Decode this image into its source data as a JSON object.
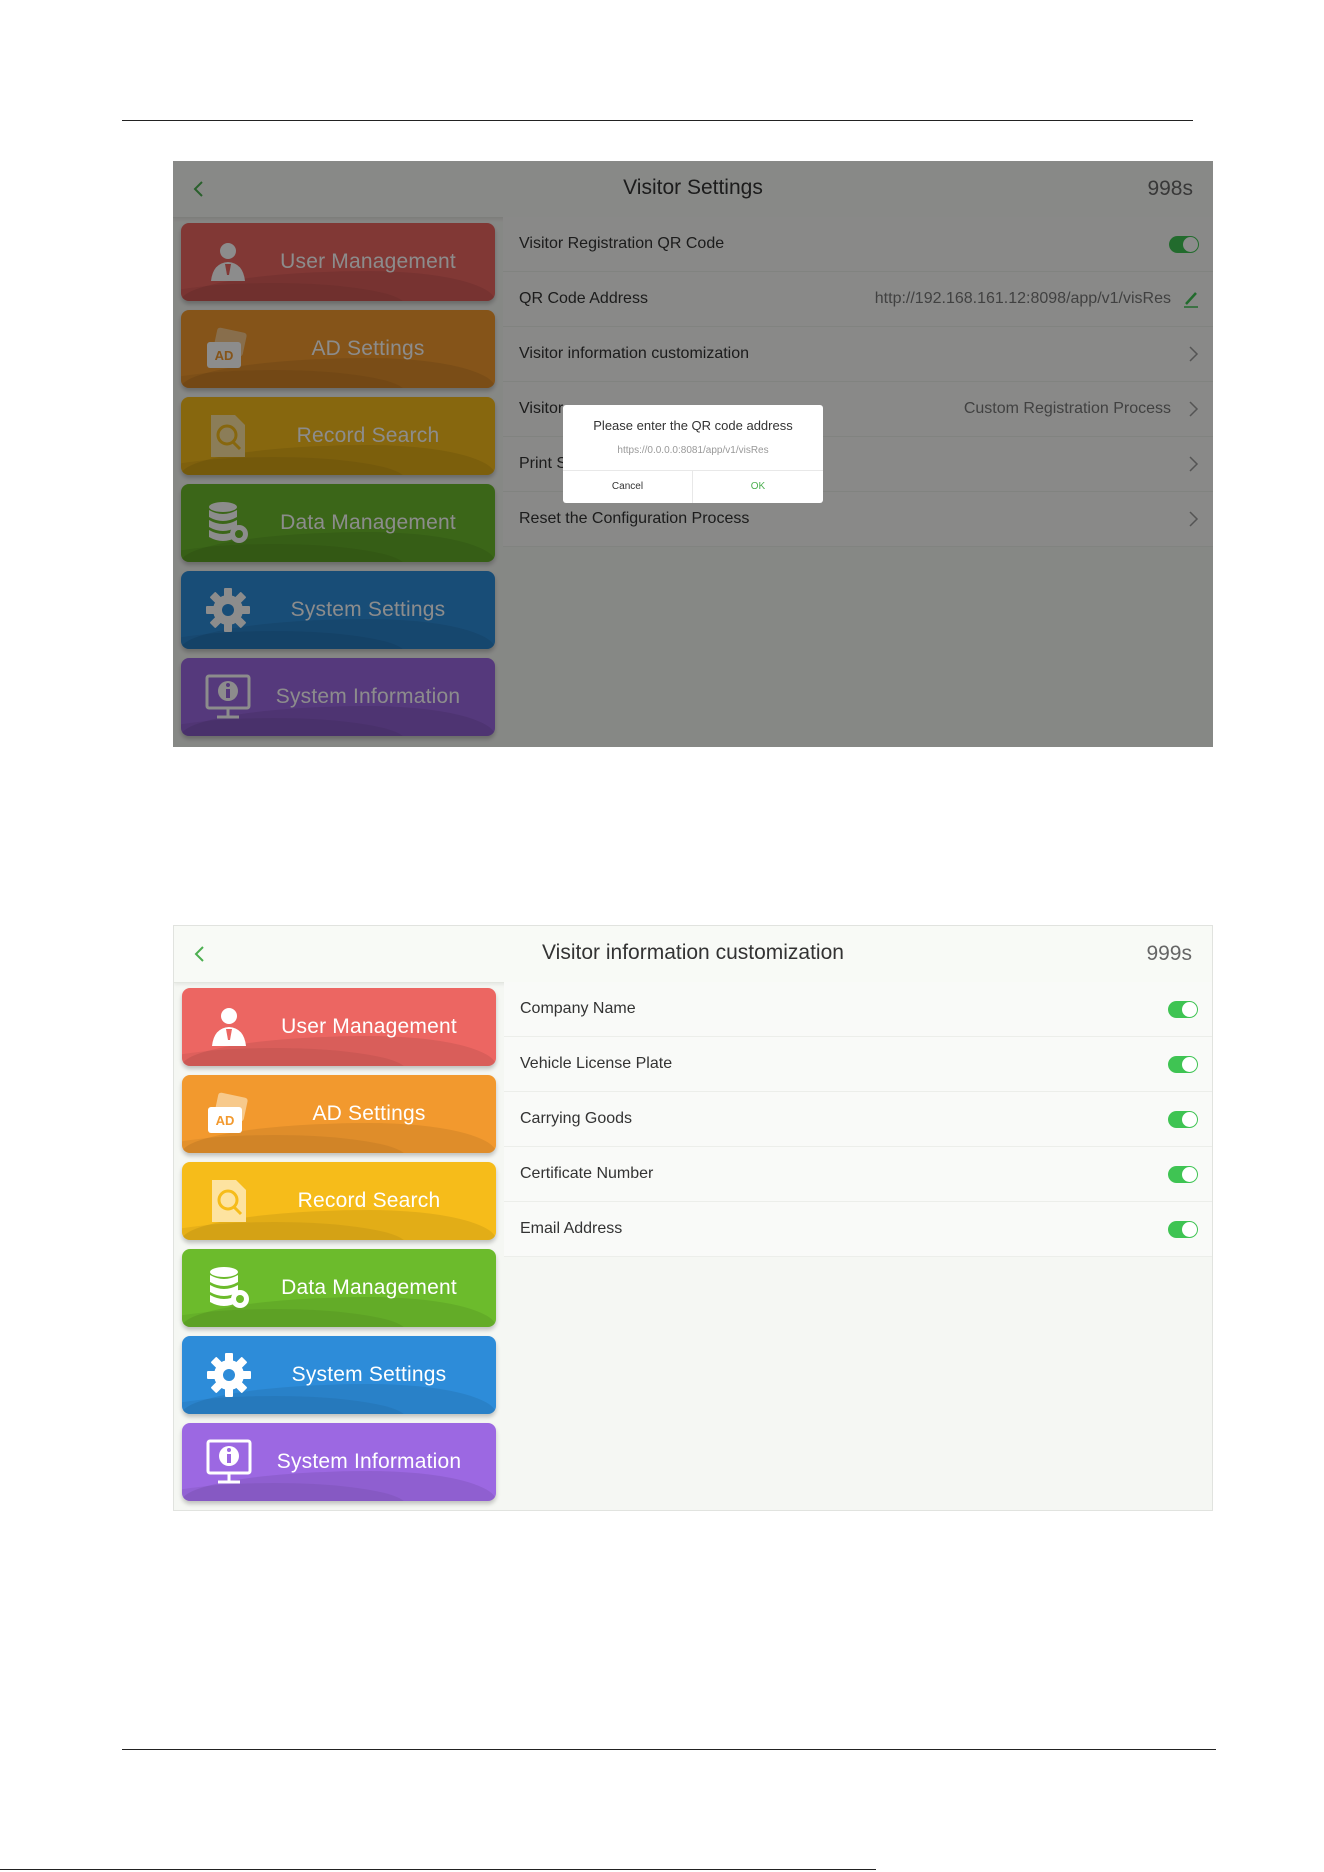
{
  "screen1": {
    "title": "Visitor Settings",
    "timer": "998s",
    "menu": [
      {
        "label": "User Management",
        "icon": "user-icon"
      },
      {
        "label": "AD Settings",
        "icon": "ad-icon",
        "badge": "AD"
      },
      {
        "label": "Record Search",
        "icon": "search-document-icon"
      },
      {
        "label": "Data Management",
        "icon": "database-gear-icon"
      },
      {
        "label": "System Settings",
        "icon": "gear-icon"
      },
      {
        "label": "System Information",
        "icon": "info-monitor-icon"
      }
    ],
    "rows": [
      {
        "label": "Visitor Registration QR Code",
        "control": "toggle",
        "on": true
      },
      {
        "label": "QR Code Address",
        "value": "http://192.168.161.12:8098/app/v1/visRes",
        "control": "edit"
      },
      {
        "label": "Visitor information customization",
        "control": "chevron"
      },
      {
        "label": "Visitor",
        "value": "Custom Registration Process",
        "control": "chevron"
      },
      {
        "label": "Print S",
        "control": "chevron"
      },
      {
        "label": "Reset the Configuration Process",
        "control": "chevron"
      }
    ],
    "dialog": {
      "title": "Please enter the QR code address",
      "input_value": "https://0.0.0.0:8081/app/v1/visRes",
      "cancel_label": "Cancel",
      "ok_label": "OK"
    }
  },
  "screen2": {
    "title": "Visitor information customization",
    "timer": "999s",
    "menu": [
      {
        "label": "User Management",
        "icon": "user-icon"
      },
      {
        "label": "AD Settings",
        "icon": "ad-icon",
        "badge": "AD"
      },
      {
        "label": "Record Search",
        "icon": "search-document-icon"
      },
      {
        "label": "Data Management",
        "icon": "database-gear-icon"
      },
      {
        "label": "System Settings",
        "icon": "gear-icon"
      },
      {
        "label": "System Information",
        "icon": "info-monitor-icon"
      }
    ],
    "rows": [
      {
        "label": "Company Name",
        "on": true
      },
      {
        "label": "Vehicle License Plate",
        "on": true
      },
      {
        "label": "Carrying Goods",
        "on": true
      },
      {
        "label": "Certificate Number",
        "on": true
      },
      {
        "label": "Email Address",
        "on": true
      }
    ]
  },
  "colors": {
    "accent_green": "#3fc453",
    "menu_red": "#ec6662",
    "menu_orange": "#f2992e",
    "menu_yellow": "#f6bc1a",
    "menu_green": "#6cbb2c",
    "menu_blue": "#2d8cd9",
    "menu_purple": "#9c68e2"
  }
}
